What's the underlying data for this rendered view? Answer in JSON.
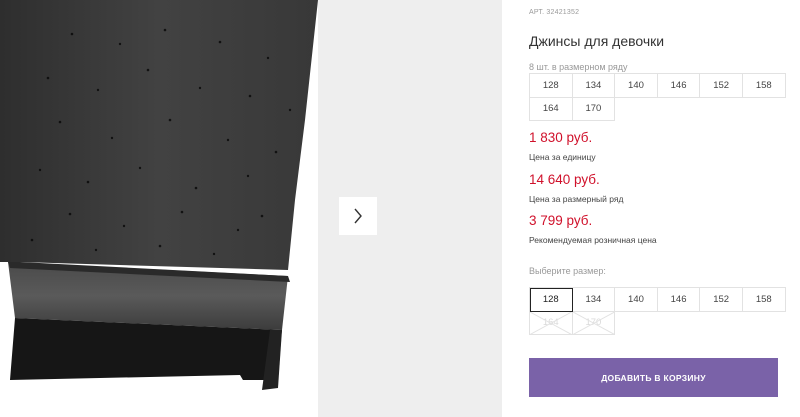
{
  "product": {
    "sku": "АРТ. 32421352",
    "title": "Джинсы для девочки",
    "pack_note": "8 шт. в размерном ряду"
  },
  "size_range": [
    "128",
    "134",
    "140",
    "146",
    "152",
    "158",
    "164",
    "170"
  ],
  "prices": [
    {
      "value": "1 830 руб.",
      "label": "Цена за единицу"
    },
    {
      "value": "14 640 руб.",
      "label": "Цена за размерный ряд"
    },
    {
      "value": "3 799 руб.",
      "label": "Рекомендуемая розничная цена"
    }
  ],
  "size_picker": {
    "label": "Выберите размер:",
    "options": [
      {
        "label": "128",
        "state": "selected"
      },
      {
        "label": "134",
        "state": "available"
      },
      {
        "label": "140",
        "state": "available"
      },
      {
        "label": "146",
        "state": "available"
      },
      {
        "label": "152",
        "state": "available"
      },
      {
        "label": "158",
        "state": "available"
      },
      {
        "label": "164",
        "state": "disabled"
      },
      {
        "label": "170",
        "state": "disabled"
      }
    ]
  },
  "cart_button": {
    "label": "ДОБАВИТЬ В КОРЗИНУ"
  },
  "gallery": {
    "next_icon": "chevron-right-icon"
  },
  "colors": {
    "price": "#d0112b",
    "button": "#7a62a8",
    "gallery_bg": "#eeeeee",
    "denim": "#3b3b3b"
  }
}
